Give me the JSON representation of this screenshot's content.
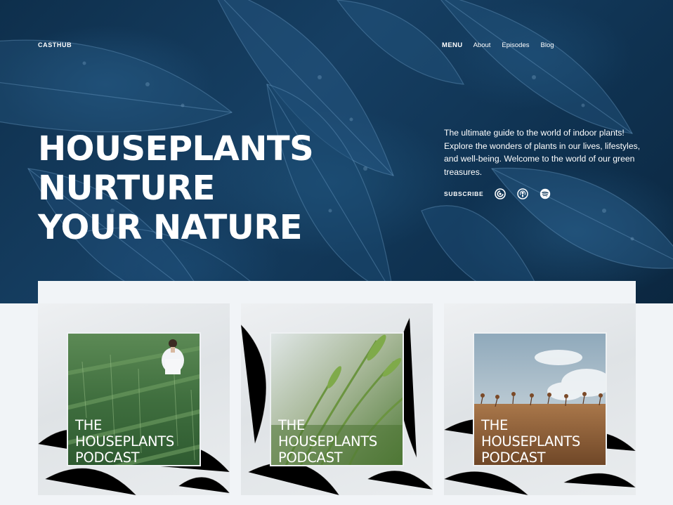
{
  "header": {
    "brand": "CASTHUB",
    "nav": {
      "menu": "MENU",
      "about": "About",
      "episodes": "Episodes",
      "blog": "Blog"
    }
  },
  "hero": {
    "headline": [
      "HOUSEPLANTS",
      "NURTURE",
      "YOUR NATURE"
    ],
    "tagline": "The ultimate guide to the world of indoor plants! Explore the wonders of plants in our lives, lifestyles, and well-being. Welcome to the world of our green treasures.",
    "subscribe_label": "SUBSCRIBE",
    "subscribe_icons": [
      "pocket-casts-icon",
      "apple-podcasts-icon",
      "spotify-icon"
    ]
  },
  "episodes": [
    {
      "title": [
        "THE",
        "HOUSEPLANTS",
        "PODCAST"
      ],
      "cover": "woman-in-wheat-field"
    },
    {
      "title": [
        "THE",
        "HOUSEPLANTS",
        "PODCAST"
      ],
      "cover": "green-barley-closeup"
    },
    {
      "title": [
        "THE",
        "HOUSEPLANTS",
        "PODCAST"
      ],
      "cover": "golden-field-blue-sky"
    }
  ],
  "colors": {
    "hero_bg": "#123a5c",
    "page_bg": "#f1f4f7",
    "text_light": "#ffffff"
  }
}
